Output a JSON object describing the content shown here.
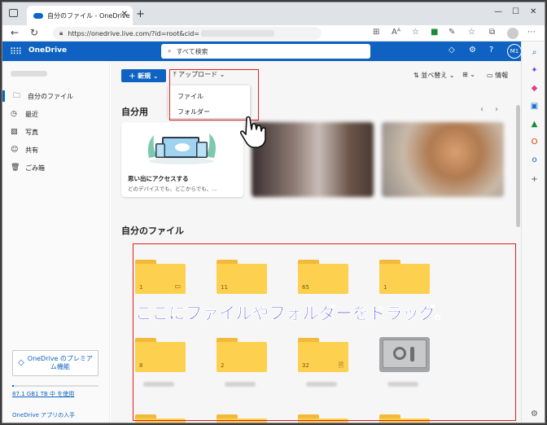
{
  "browser": {
    "tab_title": "自分のファイル - OneDrive",
    "tab_close": "✕",
    "new_tab": "+",
    "url": "https://onedrive.live.com/?id=root&cid="
  },
  "header": {
    "app_name": "OneDrive",
    "search_placeholder": "すべて検索",
    "account_initials": "M1"
  },
  "nav": {
    "items": [
      {
        "label": "自分のファイル"
      },
      {
        "label": "最近"
      },
      {
        "label": "写真"
      },
      {
        "label": "共有"
      },
      {
        "label": "ごみ箱"
      }
    ],
    "premium_line1": "OneDrive のプレミア",
    "premium_line2": "ム機能",
    "storage_text": "87.1 GB1 TB 中 を使用",
    "get_app": "OneDrive アプリの入手"
  },
  "toolbar": {
    "new_label": "＋ 新規 ⌄",
    "upload_label": "アップロード",
    "sort_label": "並べ替え",
    "info_label": "情報"
  },
  "upload_menu": {
    "file": "ファイル",
    "folder": "フォルダー"
  },
  "for_you": {
    "heading": "自分用",
    "card_title": "思い出にアクセスする",
    "card_sub": "どのデバイスでも、どこからでも、..."
  },
  "files": {
    "heading": "自分のファイル",
    "folders": [
      {
        "count": "1",
        "icon": "slideshow-icon"
      },
      {
        "count": "11"
      },
      {
        "count": "65"
      },
      {
        "count": "1"
      },
      {
        "count": "8"
      },
      {
        "count": "2"
      },
      {
        "count": "32",
        "icon": "document-icon"
      }
    ]
  },
  "annotation": "ここにファイルやフォルダーをドラッグ。",
  "colors": {
    "brand": "#0f62c1",
    "annotation": "#1414d6",
    "highlight_box": "#e02020",
    "folder": "#fdd04f"
  }
}
